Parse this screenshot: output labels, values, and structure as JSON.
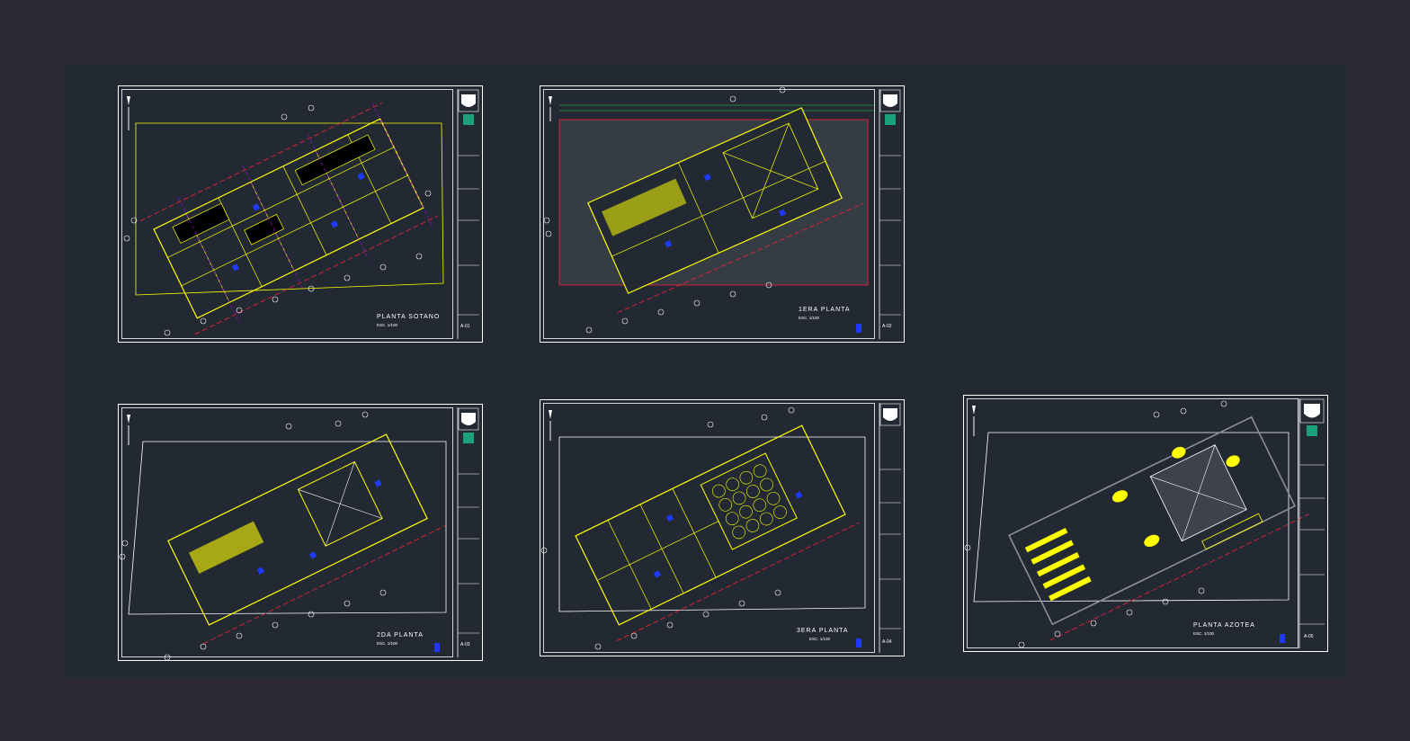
{
  "canvas": {
    "background": "#2c2832",
    "model_space_color": "#222933"
  },
  "colors": {
    "frame": "#ffffff",
    "linework": "#ffff00",
    "grid": "#ff1f3a",
    "axis": "#b000ff",
    "marker": "#1f3aff",
    "title_block": "#ffffff"
  },
  "sheets": [
    {
      "id": "A-01",
      "title": "PLANTA SOTANO",
      "scale": "ESC. 1/100",
      "code": "A-01"
    },
    {
      "id": "A-02",
      "title": "1ERA PLANTA",
      "scale": "ESC. 1/100",
      "code": "A-02"
    },
    {
      "id": "A-03",
      "title": "2DA PLANTA",
      "scale": "ESC. 1/100",
      "code": "A-03"
    },
    {
      "id": "A-04",
      "title": "3ERA PLANTA",
      "scale": "ESC. 1/100",
      "code": "A-04"
    },
    {
      "id": "A-05",
      "title": "PLANTA AZOTEA",
      "scale": "ESC. 1/100",
      "code": "A-05"
    }
  ]
}
